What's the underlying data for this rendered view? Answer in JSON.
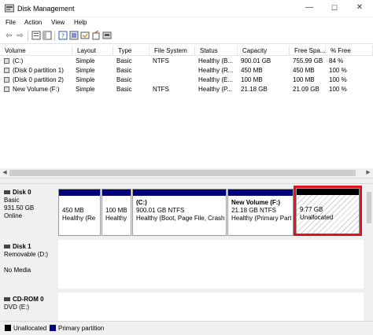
{
  "window": {
    "title": "Disk Management",
    "minimize_glyph": "—",
    "maximize_glyph": "☐",
    "close_glyph": "✕"
  },
  "menu": [
    "File",
    "Action",
    "View",
    "Help"
  ],
  "toolbar": [
    "back-icon",
    "forward-icon",
    "properties-icon",
    "help-icon",
    "help-book-icon",
    "rescan-icon",
    "check-icon",
    "disk-icon"
  ],
  "volume_table": {
    "columns": [
      "Volume",
      "Layout",
      "Type",
      "File System",
      "Status",
      "Capacity",
      "Free Spa...",
      "% Free"
    ],
    "rows": [
      [
        "(C:)",
        "Simple",
        "Basic",
        "NTFS",
        "Healthy (B...",
        "900.01 GB",
        "755.99 GB",
        "84 %"
      ],
      [
        "(Disk 0 partition 1)",
        "Simple",
        "Basic",
        "",
        "Healthy (R...",
        "450 MB",
        "450 MB",
        "100 %"
      ],
      [
        "(Disk 0 partition 2)",
        "Simple",
        "Basic",
        "",
        "Healthy (E...",
        "100 MB",
        "100 MB",
        "100 %"
      ],
      [
        "New Volume (F:)",
        "Simple",
        "Basic",
        "NTFS",
        "Healthy (P...",
        "21.18 GB",
        "21.09 GB",
        "100 %"
      ]
    ]
  },
  "disks": [
    {
      "name": "Disk 0",
      "type": "Basic",
      "size": "931.50 GB",
      "status": "Online",
      "partitions": [
        {
          "title": "",
          "line1": "450 MB",
          "line2": "Healthy (Re"
        },
        {
          "title": "",
          "line1": "100 MB",
          "line2": "Healthy"
        },
        {
          "title": "(C:)",
          "line1": "900.01 GB NTFS",
          "line2": "Healthy (Boot, Page File, Crash"
        },
        {
          "title": "New Volume  (F:)",
          "line1": "21.18 GB NTFS",
          "line2": "Healthy (Primary Part"
        },
        {
          "title": "",
          "line1": "9.77 GB",
          "line2": "Unallocated"
        }
      ]
    },
    {
      "name": "Disk 1",
      "type": "Removable (D:)",
      "size": "",
      "status": "No Media"
    },
    {
      "name": "CD-ROM 0",
      "type": "DVD (E:)",
      "size": "",
      "status": ""
    }
  ],
  "legend": [
    {
      "label": "Unallocated",
      "color": "#000000"
    },
    {
      "label": "Primary partition",
      "color": "#00007f"
    }
  ],
  "colors": {
    "primary": "#00007f",
    "highlight": "#e0141e"
  }
}
